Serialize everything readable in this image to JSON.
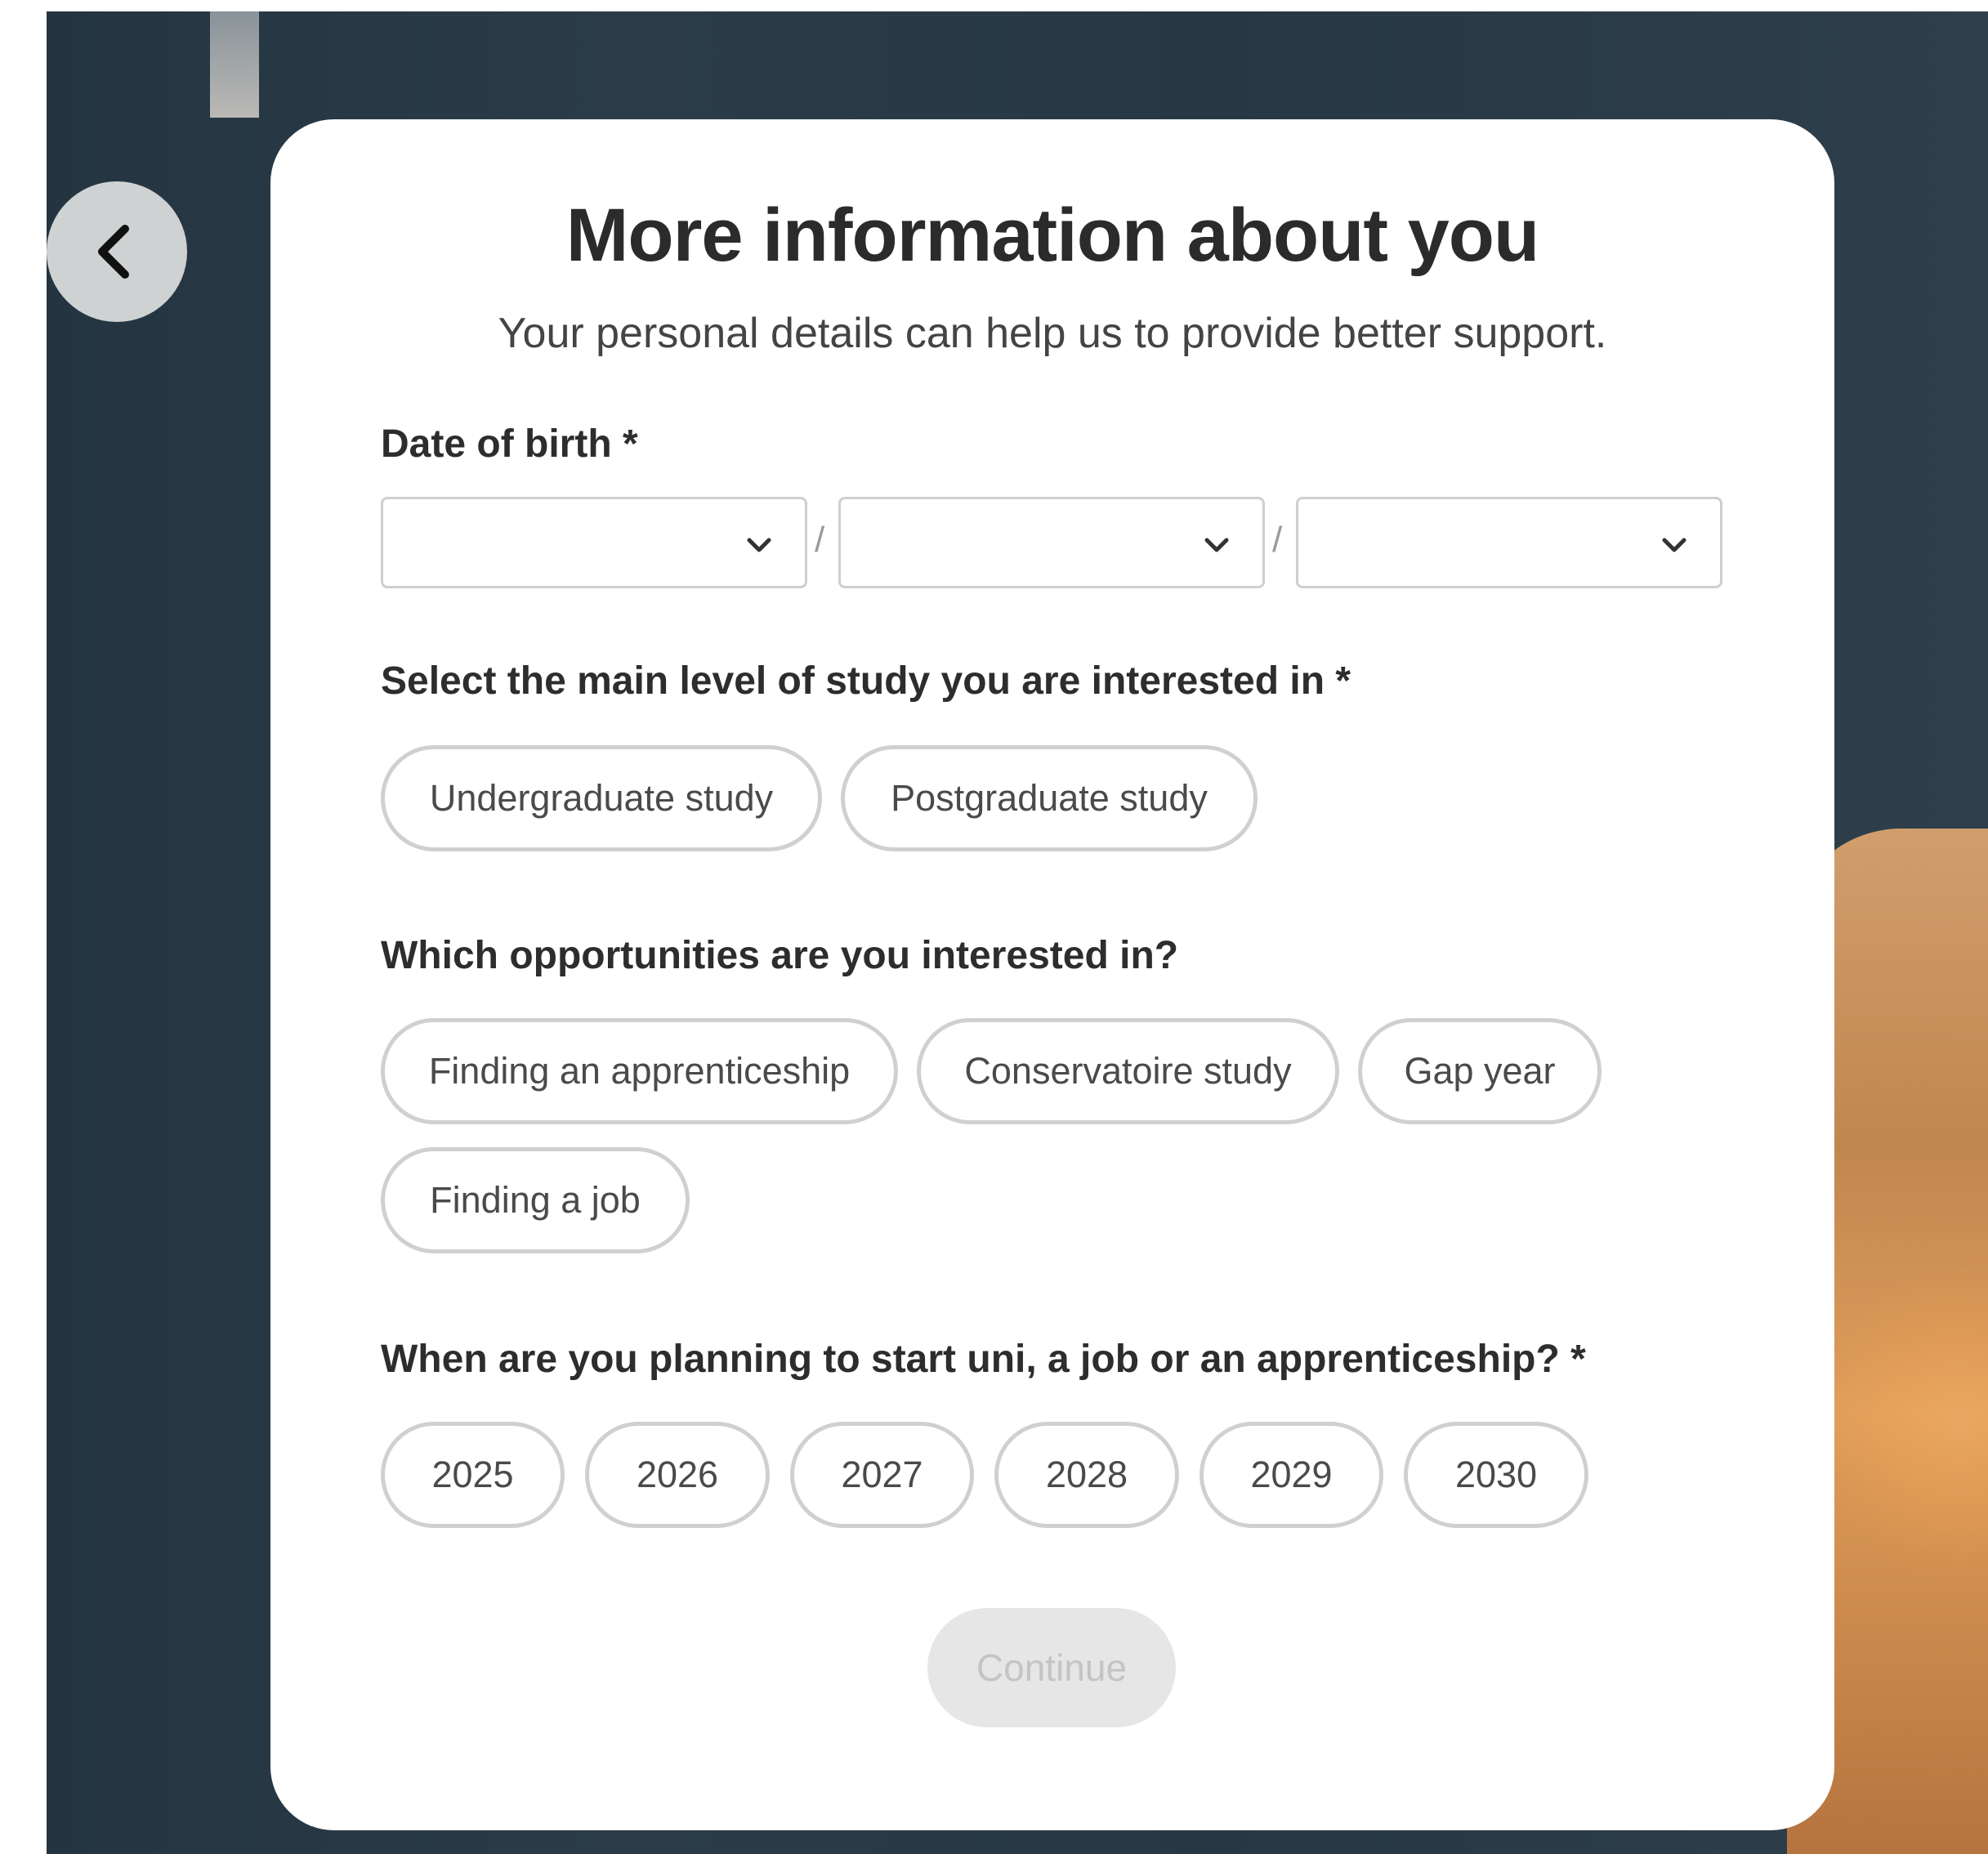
{
  "header": {
    "title": "More information about you",
    "subtitle": "Your personal details can help us to provide better support."
  },
  "icons": {
    "back": "chevron-left-icon",
    "dropdown": "chevron-down-icon"
  },
  "dob": {
    "label": "Date of birth *",
    "separator": "/",
    "day_value": "",
    "month_value": "",
    "year_value": ""
  },
  "study_level": {
    "label": "Select the main level of study you are interested in *",
    "options": [
      "Undergraduate study",
      "Postgraduate study"
    ]
  },
  "opportunities": {
    "label": "Which opportunities are you interested in?",
    "options": [
      "Finding an apprenticeship",
      "Conservatoire study",
      "Gap year",
      "Finding a job"
    ]
  },
  "start_year": {
    "label": "When are you planning to start uni, a job or an apprenticeship? *",
    "options": [
      "2025",
      "2026",
      "2027",
      "2028",
      "2029",
      "2030"
    ]
  },
  "footer": {
    "continue_label": "Continue"
  },
  "colors": {
    "pill_border": "#d0d0d0",
    "continue_disabled_bg": "#e6e6e6",
    "continue_disabled_text": "#c4c4c4",
    "heading_text": "#2b2b2b"
  }
}
